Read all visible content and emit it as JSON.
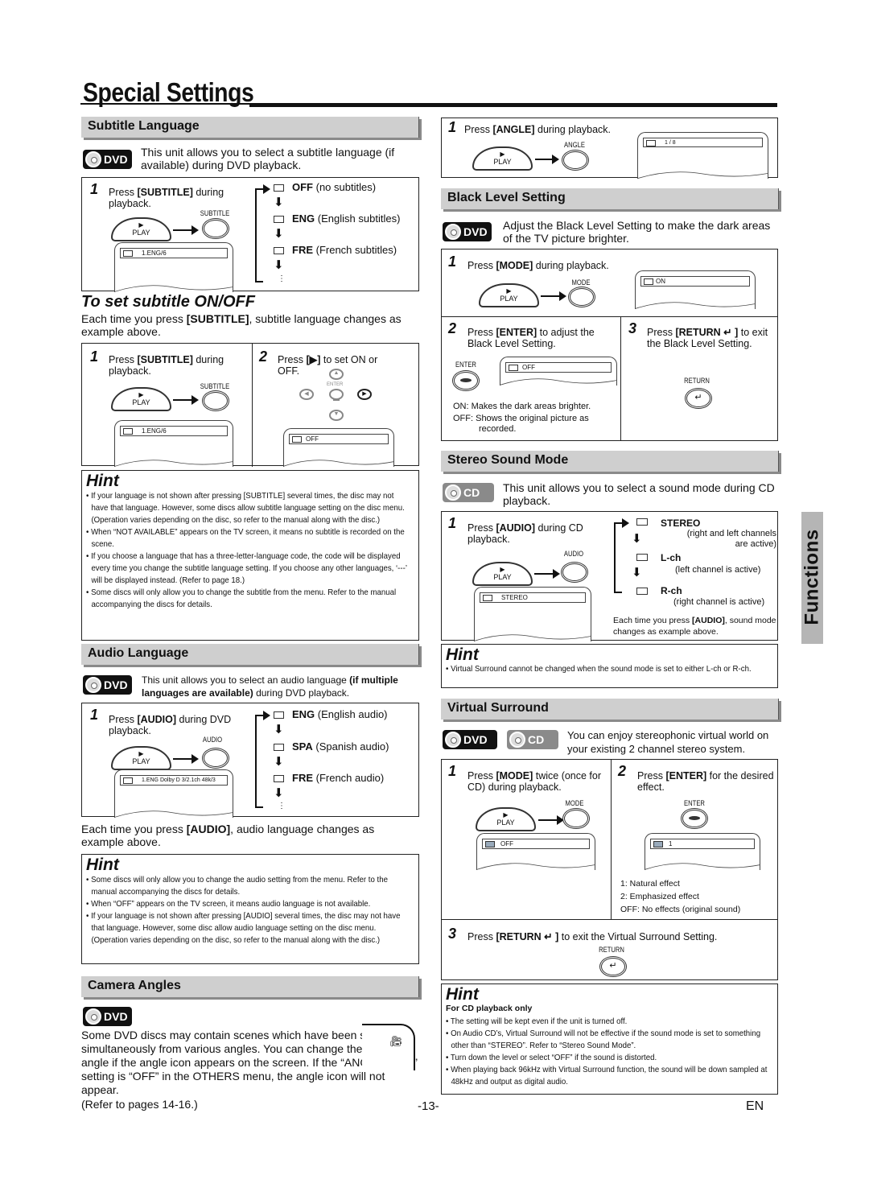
{
  "page": {
    "title": "Special Settings",
    "side_tab": "Functions",
    "page_number": "-13-",
    "language_code": "EN"
  },
  "subtitle_language": {
    "heading": "Subtitle Language",
    "badge": "DVD",
    "intro": "This unit allows you to select a subtitle language (if available) during DVD playback.",
    "step1": {
      "num": "1",
      "text_pre": "Press ",
      "key": "[SUBTITLE]",
      "text_post": " during playback."
    },
    "play_label": "PLAY",
    "button_label": "SUBTITLE",
    "tv_text": "1.ENG/6",
    "options": [
      {
        "code": "OFF",
        "desc": "(no subtitles)"
      },
      {
        "code": "ENG",
        "desc": "(English subtitles)"
      },
      {
        "code": "FRE",
        "desc": "(French subtitles)"
      }
    ],
    "ellipsis": "⋮"
  },
  "subtitle_onoff": {
    "heading": "To set subtitle ON/OFF",
    "intro_pre": "Each time you press ",
    "intro_key": "[SUBTITLE]",
    "intro_post": ", subtitle language changes as example above.",
    "step1": {
      "num": "1",
      "text_pre": "Press ",
      "key": "[SUBTITLE]",
      "text_post": " during playback."
    },
    "step2": {
      "num": "2",
      "text_pre": "Press ",
      "key": "[▶]",
      "text_post": " to set ON or OFF."
    },
    "play_label": "PLAY",
    "button_label": "SUBTITLE",
    "enter_label": "ENTER",
    "tv1_text": "1.ENG/6",
    "tv2_text": "OFF"
  },
  "hint1": {
    "title": "Hint",
    "items": [
      "If your language is not shown after pressing [SUBTITLE] several times, the disc may not have that language. However, some discs allow subtitle language setting on the disc menu. (Operation varies depending on the disc, so refer to the manual along with the disc.)",
      "When “NOT AVAILABLE” appears on the TV screen, it means no subtitle is recorded on the scene.",
      "If you choose a language that has a three-letter-language code, the code will be displayed every time you change the subtitle language setting. If you choose any other languages, ‘---’ will be displayed instead. (Refer to page 18.)",
      "Some discs will only allow you to change the subtitle from the menu. Refer to the manual accompanying the discs for details."
    ]
  },
  "audio_language": {
    "heading": "Audio Language",
    "badge": "DVD",
    "intro_pre": "This unit allows you to select an audio language ",
    "intro_bold": "(if multiple languages are available)",
    "intro_post": " during DVD playback.",
    "step1": {
      "num": "1",
      "text_pre": "Press ",
      "key": "[AUDIO]",
      "text_post": " during DVD playback."
    },
    "play_label": "PLAY",
    "button_label": "AUDIO",
    "tv_text": "1.ENG  Dolby D  3/2.1ch  48k/3",
    "options": [
      {
        "code": "ENG",
        "desc": "(English audio)"
      },
      {
        "code": "SPA",
        "desc": "(Spanish audio)"
      },
      {
        "code": "FRE",
        "desc": "(French audio)"
      }
    ],
    "ellipsis": "⋮",
    "after_pre": "Each time you press ",
    "after_key": "[AUDIO]",
    "after_post": ", audio language changes as example above."
  },
  "hint2": {
    "title": "Hint",
    "items": [
      "Some discs will only allow you to change the audio setting from the menu. Refer to the manual accompanying the discs for details.",
      "When “OFF” appears on the TV screen, it means audio language is not available.",
      "If your language is not shown after pressing [AUDIO] several times, the disc may not have that language. However, some disc allow audio language setting on the disc menu. (Operation varies depending on the disc, so refer to the manual along with the disc.)"
    ]
  },
  "camera_angles": {
    "heading": "Camera Angles",
    "badge": "DVD",
    "text": "Some DVD discs may contain scenes which have been shot simultaneously from various angles. You can change the camera angle if the angle icon appears on the screen. If the “ANGLE ICON” setting is “OFF” in the OTHERS menu, the angle icon will not appear.",
    "refer": "(Refer to pages 14-16.)",
    "step1": {
      "num": "1",
      "text_pre": "Press ",
      "key": "[ANGLE]",
      "text_post": " during playback."
    },
    "play_label": "PLAY",
    "button_label": "ANGLE",
    "tv_text": "1 / 8"
  },
  "black_level": {
    "heading": "Black Level Setting",
    "badge": "DVD",
    "intro": "Adjust the Black Level Setting to make the dark areas of the TV picture brighter.",
    "step1": {
      "num": "1",
      "text_pre": "Press ",
      "key": "[MODE]",
      "text_post": " during playback."
    },
    "play_label": "PLAY",
    "mode_label": "MODE",
    "tv1_text": "ON",
    "step2": {
      "num": "2",
      "text_pre": "Press ",
      "key": "[ENTER]",
      "text_post": " to adjust the Black Level Setting."
    },
    "enter_label": "ENTER",
    "tv2_text": "OFF",
    "on_desc": "ON: Makes the dark areas brighter.",
    "off_desc": "OFF: Shows the original picture as recorded.",
    "step3": {
      "num": "3",
      "text_pre": "Press ",
      "key": "[RETURN ↵ ]",
      "text_post": " to exit the Black Level Setting."
    },
    "return_label": "RETURN"
  },
  "stereo_sound": {
    "heading": "Stereo Sound Mode",
    "badge": "CD",
    "intro": "This unit allows you to select a sound mode during CD playback.",
    "step1": {
      "num": "1",
      "text_pre": "Press ",
      "key": "[AUDIO]",
      "text_post": " during CD playback."
    },
    "play_label": "PLAY",
    "button_label": "AUDIO",
    "tv_text": "STEREO",
    "options": [
      {
        "code": "STEREO",
        "desc": "(right and left channels are active)"
      },
      {
        "code": "L-ch",
        "desc": "(left channel is active)"
      },
      {
        "code": "R-ch",
        "desc": "(right channel is active)"
      }
    ],
    "after_pre": "Each time you press ",
    "after_key": "[AUDIO]",
    "after_post": ", sound mode changes as example above."
  },
  "hint3": {
    "title": "Hint",
    "items": [
      "Virtual Surround cannot be changed when the sound mode is set to either L-ch or R-ch."
    ]
  },
  "virtual_surround": {
    "heading": "Virtual Surround",
    "badges": [
      "DVD",
      "CD"
    ],
    "intro": "You can enjoy stereophonic virtual world on your existing 2 channel stereo system.",
    "step1": {
      "num": "1",
      "text_pre": "Press ",
      "key": "[MODE]",
      "text_post": " twice (once for CD) during  playback."
    },
    "play_label": "PLAY",
    "mode_label": "MODE",
    "tv1_text": "OFF",
    "step2": {
      "num": "2",
      "text_pre": "Press ",
      "key": "[ENTER]",
      "text_post": " for the desired effect."
    },
    "enter_label": "ENTER",
    "tv2_text": "1",
    "effects": [
      "1: Natural effect",
      "2: Emphasized effect",
      "OFF: No effects (original sound)"
    ],
    "step3": {
      "num": "3",
      "text_pre": "Press ",
      "key": "[RETURN ↵ ]",
      "text_post": " to exit the Virtual Surround Setting."
    },
    "return_label": "RETURN"
  },
  "hint4": {
    "title": "Hint",
    "subtitle": "For CD playback only",
    "items": [
      "The setting will be kept even if the unit is turned off.",
      "On Audio CD’s, Virtual Surround will not be effective if the sound mode is set to something other than “STEREO”. Refer to “Stereo Sound Mode”.",
      "Turn down the level or select “OFF” if the sound is distorted.",
      "When playing back 96kHz with Virtual Surround function, the sound will be down sampled at 48kHz and output as digital audio."
    ]
  }
}
